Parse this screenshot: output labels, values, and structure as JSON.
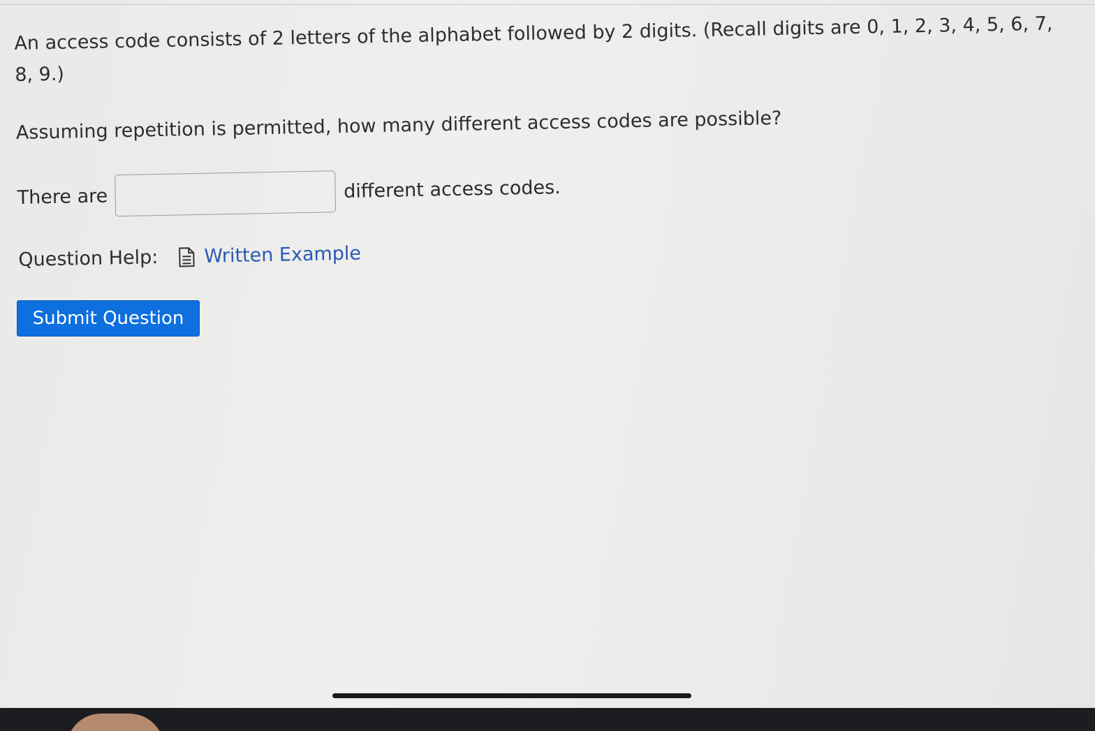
{
  "question": {
    "text1": "An access code consists of 2 letters of the alphabet followed by 2 digits. (Recall digits are 0, 1, 2, 3, 4, 5, 6, 7, 8, 9.)",
    "text2": "Assuming repetition is permitted, how many different access codes are possible?",
    "answer_prefix": "There are",
    "answer_value": "",
    "answer_suffix": "different access codes."
  },
  "help": {
    "label": "Question Help:",
    "link_label": "Written Example",
    "icon": "document-icon"
  },
  "submit": {
    "label": "Submit Question"
  },
  "colors": {
    "link": "#2a5ab5",
    "button": "#0e6fde",
    "text": "#2e2e2e"
  }
}
